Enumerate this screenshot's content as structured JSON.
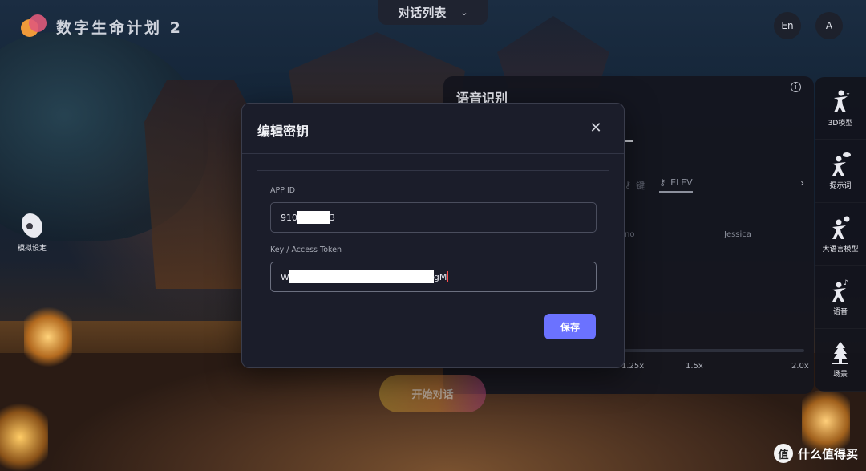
{
  "app": {
    "title": "数字生命计划 2"
  },
  "header": {
    "conversation_dropdown": "对话列表",
    "lang_button": "En",
    "user_button": "A"
  },
  "left_actions": {
    "sim_settings_label": "模拟设定"
  },
  "right_nav": {
    "items": [
      {
        "label": "3D模型",
        "icon": "figure-3d-icon"
      },
      {
        "label": "提示词",
        "icon": "figure-chat-icon"
      },
      {
        "label": "大语言模型",
        "icon": "figure-bulb-icon"
      },
      {
        "label": "语音",
        "icon": "figure-music-icon"
      },
      {
        "label": "场景",
        "icon": "tree-icon"
      }
    ]
  },
  "voice_panel": {
    "title": "语音识别",
    "tabs": [
      "键",
      "ELEV"
    ],
    "voices": [
      "no",
      "Jessica"
    ],
    "speed_labels": [
      "1.25x",
      "1.5x",
      "2.0x"
    ]
  },
  "start_button": "开始对话",
  "modal": {
    "title": "编辑密钥",
    "app_id_label": "APP ID",
    "app_id_prefix": "910",
    "app_id_suffix": "3",
    "token_label": "Key / Access Token",
    "token_prefix": "W",
    "token_suffix": "gM",
    "save_label": "保存"
  },
  "watermark": {
    "text": "什么值得买",
    "icon_char": "值"
  },
  "colors": {
    "accent": "#6b72ff",
    "modal_bg": "#1b1d2a",
    "panel_bg": "#14161e"
  }
}
